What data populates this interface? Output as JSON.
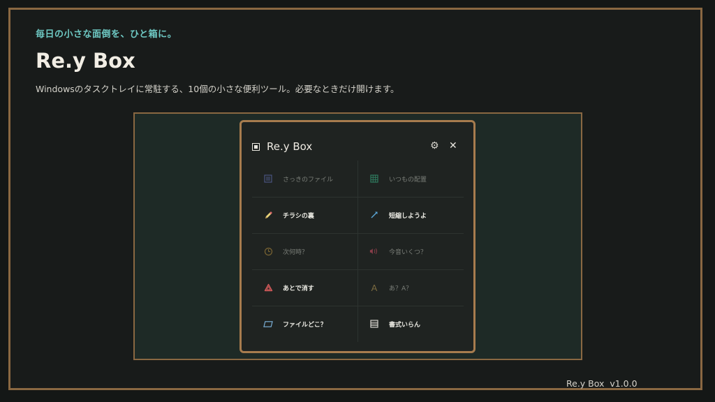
{
  "hero": {
    "tagline": "毎日の小さな面倒を、ひと箱に。",
    "title": "Re.y Box",
    "description": "Windowsのタスクトレイに常駐する、10個の小さな便利ツール。必要なときだけ開けます。"
  },
  "window": {
    "title": "Re.y Box",
    "settings_icon": "gear-icon",
    "close_icon": "close-icon",
    "tools": [
      {
        "label": "さっきのファイル",
        "icon": "list-file-icon",
        "state": "dim",
        "color": "#4a5480"
      },
      {
        "label": "いつもの配置",
        "icon": "grid-layout-icon",
        "state": "dim",
        "color": "#2f7a5e"
      },
      {
        "label": "チラシの裏",
        "icon": "pencil-icon",
        "state": "bright",
        "color": "#e9d47a"
      },
      {
        "label": "短縮しようよ",
        "icon": "arrow-icon",
        "state": "bright",
        "color": "#5aa6d6"
      },
      {
        "label": "次何時？",
        "icon": "clock-icon",
        "state": "dim",
        "color": "#7a6432"
      },
      {
        "label": "今音いくつ？",
        "icon": "sound-icon",
        "state": "dim",
        "color": "#8a3e4a"
      },
      {
        "label": "あとで消す",
        "icon": "recycle-icon",
        "state": "bright",
        "color": "#d45a5a"
      },
      {
        "label": "あ？A？",
        "icon": "letter-a-icon",
        "state": "dim",
        "color": "#7a6a40"
      },
      {
        "label": "ファイルどこ？",
        "icon": "folder-icon",
        "state": "bright",
        "color": "#7fb6e0"
      },
      {
        "label": "書式いらん",
        "icon": "text-lines-icon",
        "state": "bright",
        "color": "#d8d6d0"
      }
    ]
  },
  "footer": {
    "version": "Re.y Box  v1.0.0"
  },
  "colors": {
    "accent": "#6ec9c4",
    "border": "#8a6842",
    "window_border": "#a77c4e"
  }
}
